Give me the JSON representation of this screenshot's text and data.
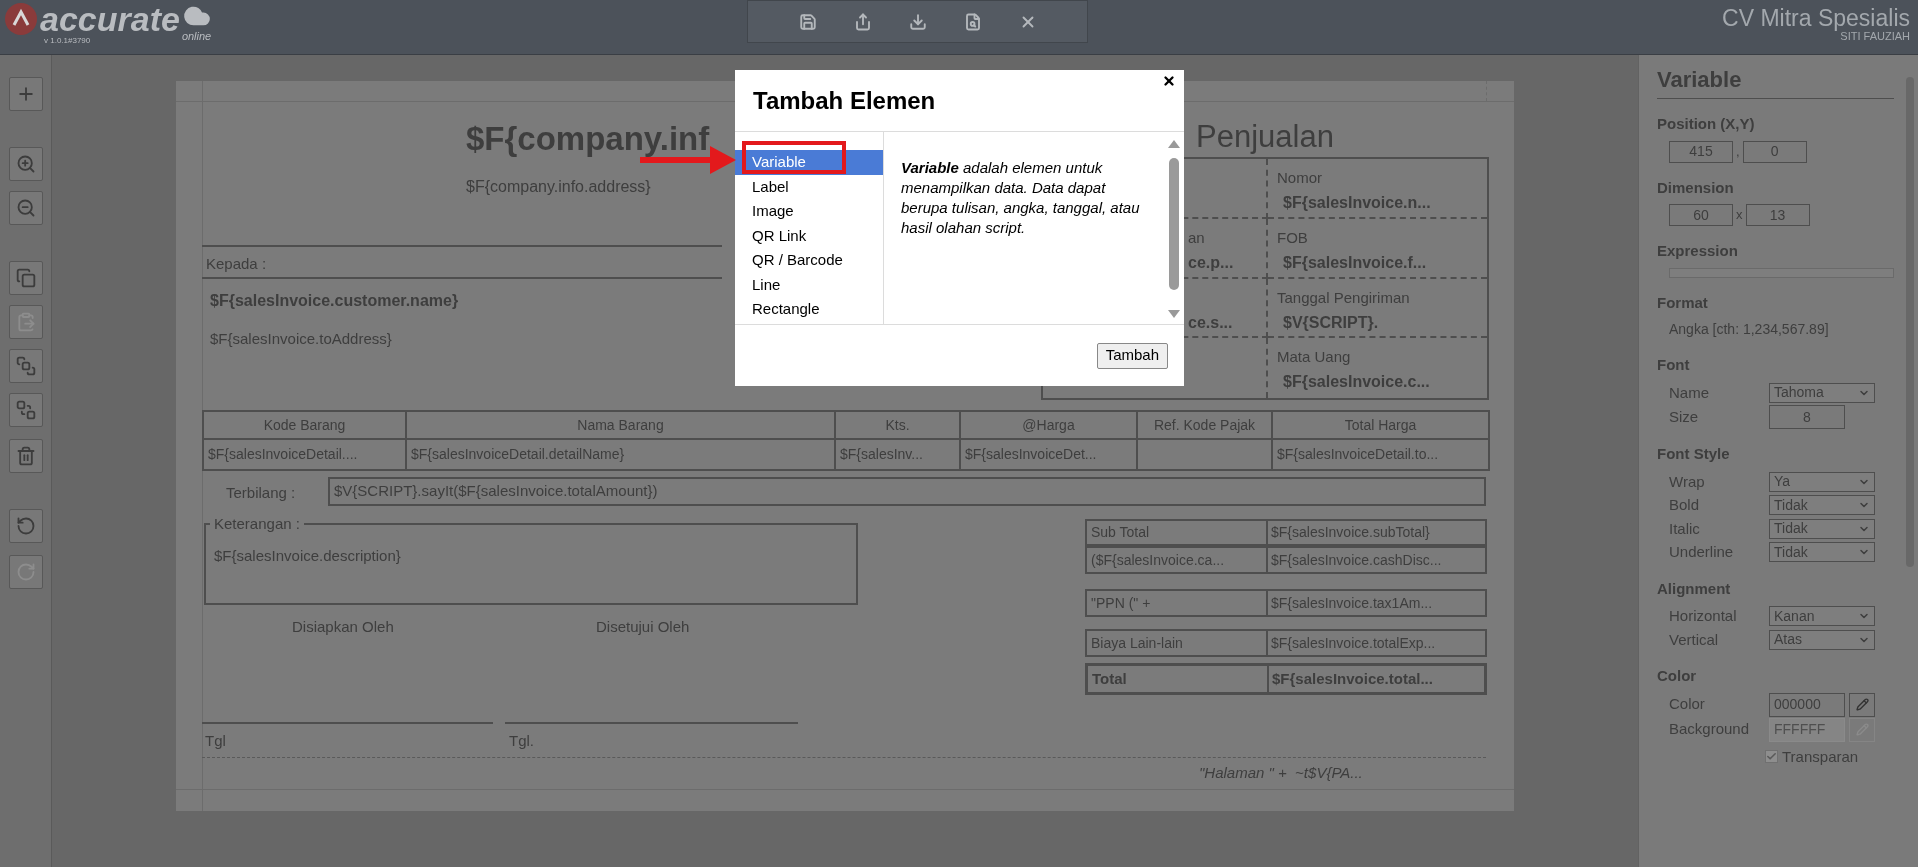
{
  "top_bar": {
    "logo": "accurate",
    "logo_sub": "online",
    "version": "v 1.0.1#3790",
    "toolbar": [
      {
        "kind": "save"
      },
      {
        "kind": "export"
      },
      {
        "kind": "download"
      },
      {
        "kind": "preview"
      },
      {
        "kind": "close"
      }
    ],
    "company": "CV Mitra Spesialis",
    "user": "SITI FAUZIAH"
  },
  "left_toolbar": [
    {
      "kind": "add",
      "disabled": false
    },
    {
      "kind": "zoomin",
      "disabled": false
    },
    {
      "kind": "zoomout",
      "disabled": false
    },
    {
      "kind": "copy",
      "disabled": false
    },
    {
      "kind": "paste",
      "disabled": true
    },
    {
      "kind": "front",
      "disabled": false
    },
    {
      "kind": "back",
      "disabled": false
    },
    {
      "kind": "delete",
      "disabled": false
    },
    {
      "kind": "undo",
      "disabled": false
    },
    {
      "kind": "redo",
      "disabled": true
    }
  ],
  "report": {
    "company_name": "$F{company.inf",
    "company_address": "$F{company.info.address}",
    "title": "Penjualan",
    "to_label": "Kepada :",
    "customer_name": "$F{salesInvoice.customer.name}",
    "customer_address": "$F{salesInvoice.toAddress}",
    "info_grid": [
      {
        "right_label": "Nomor",
        "right_value": "$F{salesInvoice.n..."
      },
      {
        "left_label": "an",
        "left_value": "ce.p...",
        "right_label": "FOB",
        "right_value": "$F{salesInvoice.f..."
      },
      {
        "left_value": "ce.s...",
        "right_label": "Tanggal Pengiriman",
        "right_value": "$V{SCRIPT}."
      },
      {
        "right_label": "Mata Uang",
        "right_value": "$F{salesInvoice.c..."
      }
    ],
    "items_table": {
      "columns": [
        "Kode Barang",
        "Nama Barang",
        "Kts.",
        "@Harga",
        "Ref. Kode Pajak",
        "Total Harga"
      ],
      "row": [
        {
          "kind": "text",
          "text": "$F{salesInvoiceDetail...."
        },
        {
          "kind": "text",
          "text": "$F{salesInvoiceDetail.detailName}"
        },
        {
          "kind": "text",
          "text": "$F{salesInv..."
        },
        {
          "kind": "text",
          "text": "$F{salesInvoiceDet..."
        },
        {
          "kind": "empty"
        },
        {
          "kind": "text",
          "text": "$F{salesInvoiceDetail.to..."
        }
      ]
    },
    "terbilang_label": "Terbilang :",
    "terbilang_value": "$V{SCRIPT}.sayIt($F{salesInvoice.totalAmount})",
    "notes_label": "Keterangan :",
    "notes_value": "$F{salesInvoice.description}",
    "signatures": [
      {
        "label": "Disiapkan Oleh",
        "date": "Tgl"
      },
      {
        "label": "Disetujui Oleh",
        "date": "Tgl."
      }
    ],
    "totals": [
      {
        "label": "Sub Total",
        "value": "$F{salesInvoice.subTotal}",
        "bold": false
      },
      {
        "label": "($F{salesInvoice.ca...",
        "value": "$F{salesInvoice.cashDisc...",
        "bold": false
      },
      {
        "label": "\"PPN (\" +",
        "value": "$F{salesInvoice.tax1Am...",
        "bold": false
      },
      {
        "label": "Biaya Lain-lain",
        "value": "$F{salesInvoice.totalExp...",
        "bold": false
      },
      {
        "label": "Total",
        "value": "$F{salesInvoice.total...",
        "bold": true
      }
    ],
    "footer": "\"Halaman \" +  ~t$V{PA..."
  },
  "properties": {
    "title": "Variable",
    "sections": [
      {
        "heading": "Position (X,Y)",
        "kind": "pair",
        "fields": [
          "415",
          "0"
        ],
        "separator": ","
      },
      {
        "heading": "Dimension",
        "kind": "pair",
        "fields": [
          "60",
          "13"
        ],
        "separator": "x"
      },
      {
        "heading": "Expression",
        "kind": "field"
      },
      {
        "heading": "Format",
        "kind": "text",
        "text": "Angka [cth: 1,234,567.89]"
      },
      {
        "heading": "Font",
        "kind": "rows",
        "rows": [
          {
            "label": "Name",
            "kind": "select",
            "value": "Tahoma"
          },
          {
            "label": "Size",
            "kind": "input",
            "value": "8"
          }
        ]
      },
      {
        "heading": "Font Style",
        "kind": "rows",
        "rows": [
          {
            "label": "Wrap",
            "kind": "select",
            "value": "Ya"
          },
          {
            "label": "Bold",
            "kind": "select",
            "value": "Tidak"
          },
          {
            "label": "Italic",
            "kind": "select",
            "value": "Tidak"
          },
          {
            "label": "Underline",
            "kind": "select",
            "value": "Tidak"
          }
        ]
      },
      {
        "heading": "Alignment",
        "kind": "rows",
        "rows": [
          {
            "label": "Horizontal",
            "kind": "select",
            "value": "Kanan"
          },
          {
            "label": "Vertical",
            "kind": "select",
            "value": "Atas"
          }
        ]
      },
      {
        "heading": "Color",
        "kind": "rows",
        "rows": [
          {
            "label": "Color",
            "kind": "color",
            "value": "000000",
            "disabled": false
          },
          {
            "label": "Background",
            "kind": "color",
            "value": "FFFFFF",
            "disabled": true
          }
        ],
        "checkbox": {
          "label": "Transparan",
          "checked": true
        }
      }
    ]
  },
  "modal": {
    "title": "Tambah Elemen",
    "items": [
      {
        "label": "Variable",
        "selected": true
      },
      {
        "label": "Label",
        "selected": false
      },
      {
        "label": "Image",
        "selected": false
      },
      {
        "label": "QR Link",
        "selected": false
      },
      {
        "label": "QR / Barcode",
        "selected": false
      },
      {
        "label": "Line",
        "selected": false
      },
      {
        "label": "Rectangle",
        "selected": false
      }
    ],
    "description": "**Variable** adalah elemen untuk menampilkan data. Data dapat berupa tulisan, angka, tanggal, atau hasil olahan script.",
    "button": "Tambah"
  }
}
